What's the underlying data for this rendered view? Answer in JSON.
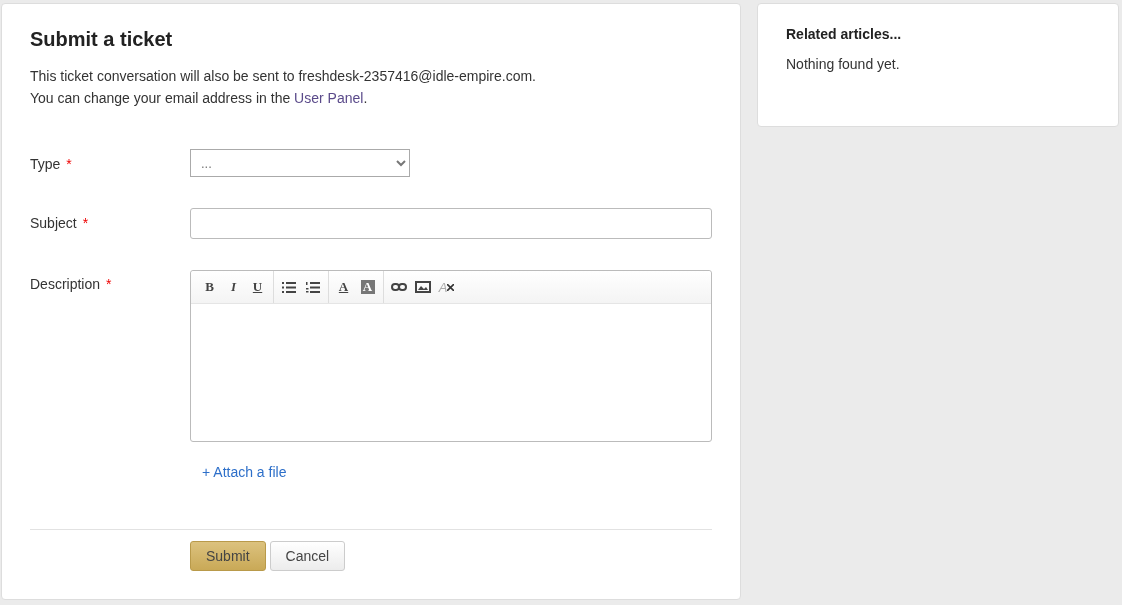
{
  "form": {
    "title": "Submit a ticket",
    "intro_line_1": "This ticket conversation will also be sent to freshdesk-2357416@idle-empire.com.",
    "intro_line_2": "You can change your email address in the ",
    "intro_link": "User Panel",
    "intro_end": ".",
    "fields": [
      {
        "kind": "select",
        "label": "Type",
        "mark": "*",
        "value": "..."
      },
      {
        "kind": "text",
        "label": "Subject",
        "mark": "*"
      },
      {
        "kind": "editor",
        "label": "Description",
        "mark": "*"
      }
    ],
    "toolbar": [
      [
        {
          "kind": "bold",
          "label": "B"
        },
        {
          "kind": "italic",
          "label": "I"
        },
        {
          "kind": "underline",
          "label": "U"
        }
      ],
      [
        {
          "kind": "bullets"
        },
        {
          "kind": "numbers"
        }
      ],
      [
        {
          "kind": "color",
          "label": "A"
        },
        {
          "kind": "highlight",
          "label": "A"
        }
      ],
      [
        {
          "kind": "link"
        },
        {
          "kind": "image"
        },
        {
          "kind": "clear",
          "label": "A"
        }
      ]
    ],
    "attach": "+ Attach a file",
    "buttons": [
      {
        "kind": "primary",
        "label": "Submit"
      },
      {
        "kind": "secondary",
        "label": "Cancel"
      }
    ]
  },
  "sidebar": {
    "title": "Related articles...",
    "text": "Nothing found yet."
  }
}
